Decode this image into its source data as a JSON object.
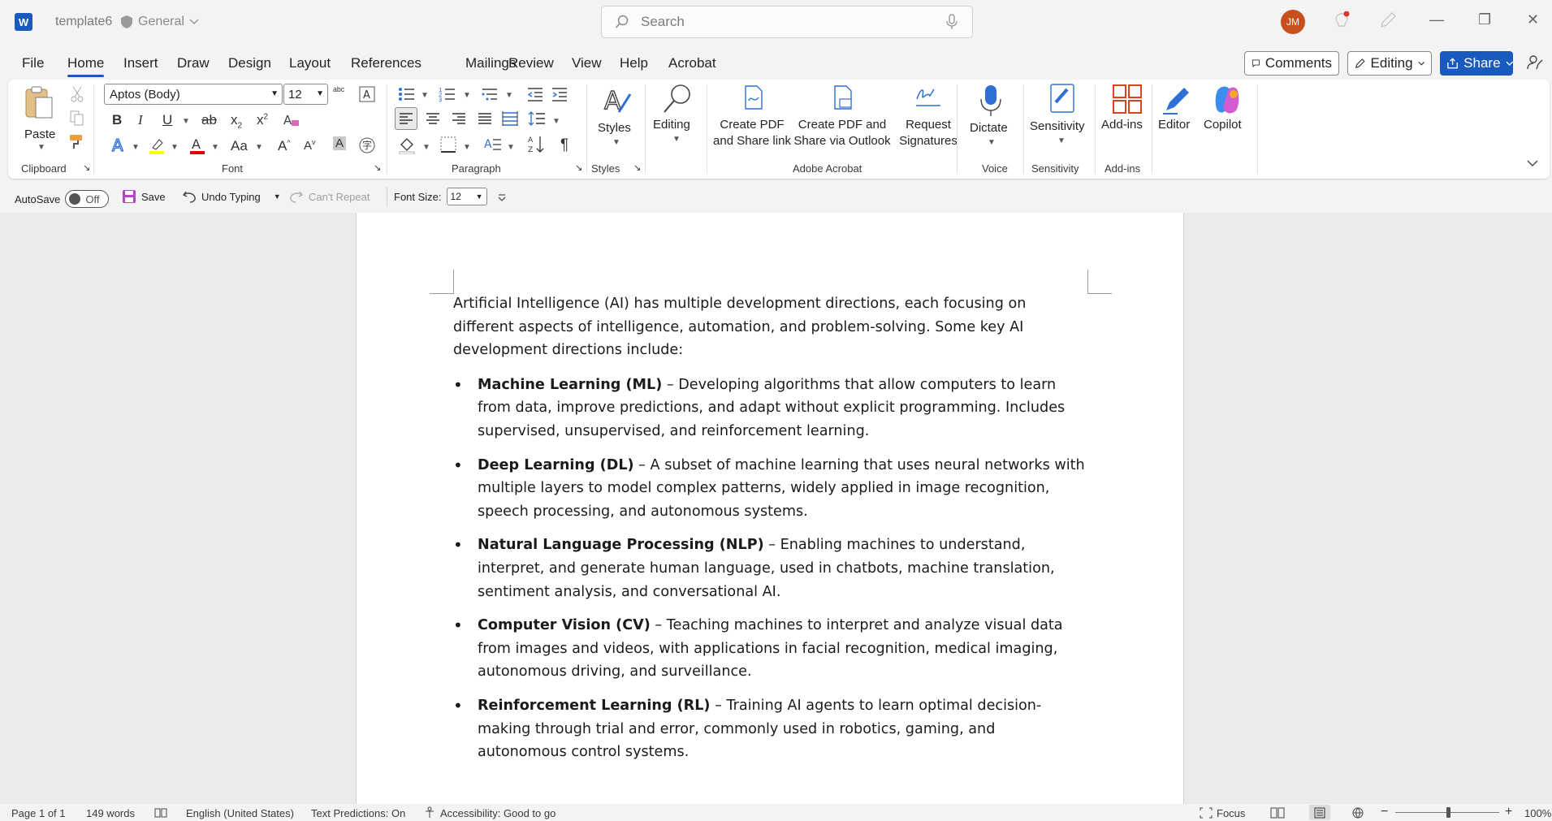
{
  "app": {
    "logo_letter": "W",
    "doc_title": "template6",
    "sensitivity_label": "General",
    "search_placeholder": "Search",
    "user_initials": "JM"
  },
  "tabs": [
    "File",
    "Home",
    "Insert",
    "Draw",
    "Design",
    "Layout",
    "References",
    "Mailings",
    "Review",
    "View",
    "Help",
    "Acrobat"
  ],
  "active_tab": "Home",
  "header_buttons": {
    "comments": "Comments",
    "editing": "Editing",
    "share": "Share"
  },
  "ribbon": {
    "clipboard": {
      "paste": "Paste",
      "group": "Clipboard"
    },
    "font": {
      "name": "Aptos (Body)",
      "size": "12",
      "group": "Font",
      "case_label": "Aa"
    },
    "paragraph": {
      "group": "Paragraph"
    },
    "styles": {
      "label": "Styles",
      "group": "Styles"
    },
    "editing": {
      "label": "Editing"
    },
    "acrobat": {
      "create_pdf_line1": "Create PDF",
      "create_pdf_line2": "and Share link",
      "create_outlook_line1": "Create PDF and",
      "create_outlook_line2": "Share via Outlook",
      "request_line1": "Request",
      "request_line2": "Signatures",
      "group": "Adobe Acrobat"
    },
    "voice": {
      "dictate": "Dictate",
      "group": "Voice"
    },
    "sensitivity": {
      "label": "Sensitivity",
      "group": "Sensitivity"
    },
    "addins": {
      "label": "Add-ins",
      "group": "Add-ins"
    },
    "editor": "Editor",
    "copilot": "Copilot"
  },
  "qat": {
    "autosave": "AutoSave",
    "autosave_state": "Off",
    "save": "Save",
    "undo": "Undo Typing",
    "repeat": "Can't Repeat",
    "font_size_label": "Font Size:",
    "font_size_value": "12"
  },
  "document": {
    "intro": "Artificial Intelligence (AI) has multiple development directions, each focusing on different aspects of intelligence, automation, and problem-solving. Some key AI development directions include:",
    "items": [
      {
        "term": "Machine Learning (ML)",
        "desc": " – Developing algorithms that allow computers to learn from data, improve predictions, and adapt without explicit programming. Includes supervised, unsupervised, and reinforcement learning."
      },
      {
        "term": "Deep Learning (DL)",
        "desc": " – A subset of machine learning that uses neural networks with multiple layers to model complex patterns, widely applied in image recognition, speech processing, and autonomous systems."
      },
      {
        "term": "Natural Language Processing (NLP)",
        "desc": " – Enabling machines to understand, interpret, and generate human language, used in chatbots, machine translation, sentiment analysis, and conversational AI."
      },
      {
        "term": "Computer Vision (CV)",
        "desc": " – Teaching machines to interpret and analyze visual data from images and videos, with applications in facial recognition, medical imaging, autonomous driving, and surveillance."
      },
      {
        "term": "Reinforcement Learning (RL)",
        "desc": " – Training AI agents to learn optimal decision-making through trial and error, commonly used in robotics, gaming, and autonomous control systems."
      }
    ]
  },
  "status": {
    "page": "Page 1 of 1",
    "words": "149 words",
    "language": "English (United States)",
    "predictions": "Text Predictions: On",
    "accessibility": "Accessibility: Good to go",
    "focus": "Focus",
    "zoom": "100%",
    "zoom_level": 1.0
  },
  "colors": {
    "accent": "#185abd",
    "avatar": "#c8501e",
    "highlight": "#ffff00",
    "font_color": "#e00000",
    "addins": "#d9431e"
  }
}
